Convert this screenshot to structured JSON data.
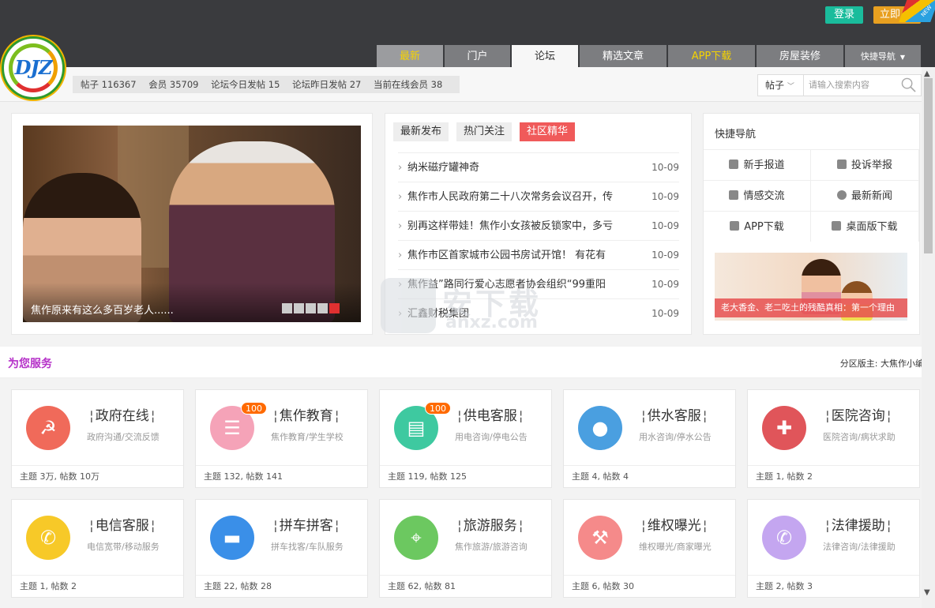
{
  "header": {
    "logo_text": "DJZ",
    "login_label": "登录",
    "register_label": "立即",
    "new_badge": "NEW",
    "tabs": [
      {
        "label": "最新"
      },
      {
        "label": "门户"
      },
      {
        "label": "论坛"
      },
      {
        "label": "精选文章"
      },
      {
        "label": "APP下载"
      },
      {
        "label": "房屋装修"
      },
      {
        "label": "快捷导航"
      }
    ]
  },
  "stats": {
    "posts": "帖子 116367",
    "members": "会员 35709",
    "today": "论坛今日发帖 15",
    "yesterday": "论坛昨日发帖 27",
    "online": "当前在线会员 38"
  },
  "search": {
    "type": "帖子",
    "placeholder": "请输入搜索内容"
  },
  "slider": {
    "caption": "焦作原来有这么多百岁老人......",
    "active_dot": 5,
    "dot_count": 5
  },
  "news": {
    "tabs": [
      "最新发布",
      "热门关注",
      "社区精华"
    ],
    "active_tab": 2,
    "items": [
      {
        "title": "纳米磁疗罐神奇",
        "date": "10-09"
      },
      {
        "title": "焦作市人民政府第二十八次常务会议召开，传",
        "date": "10-09"
      },
      {
        "title": "别再这样带娃！焦作小女孩被反锁家中，多亏",
        "date": "10-09"
      },
      {
        "title": "焦作市区首家城市公园书房试开馆！ 有花有",
        "date": "10-09"
      },
      {
        "title": "焦作益”路同行爱心志愿者协会组织“99重阳",
        "date": "10-09"
      },
      {
        "title": "汇鑫财税集团",
        "date": "10-09"
      }
    ]
  },
  "quick_nav": {
    "title": "快捷导航",
    "items": [
      {
        "label": "新手报道",
        "icon": "person-icon"
      },
      {
        "label": "投诉举报",
        "icon": "flag-icon"
      },
      {
        "label": "情感交流",
        "icon": "chat-icon"
      },
      {
        "label": "最新新闻",
        "icon": "info-icon"
      },
      {
        "label": "APP下载",
        "icon": "download-icon"
      },
      {
        "label": "桌面版下载",
        "icon": "download-icon"
      }
    ],
    "banner_caption": "老大香金、老二吃土的残酷真相：第一个理由"
  },
  "services_section": {
    "title": "为您服务",
    "moderator": "分区版主: 大焦作小编"
  },
  "services": [
    {
      "name": "政府在线",
      "desc": "政府沟通/交流反馈",
      "stats": "主题 3万, 帖数 10万",
      "color": "#f06a5a",
      "icon": "party-emblem-icon",
      "glyph": "☭",
      "badge": ""
    },
    {
      "name": "焦作教育",
      "desc": "焦作教育/学生学校",
      "stats": "主题 132, 帖数 141",
      "color": "#f5a3b8",
      "icon": "clipboard-icon",
      "glyph": "☰",
      "badge": "100"
    },
    {
      "name": "供电客服",
      "desc": "用电咨询/停电公告",
      "stats": "主题 119, 帖数 125",
      "color": "#3ec9a0",
      "icon": "list-icon",
      "glyph": "▤",
      "badge": "100"
    },
    {
      "name": "供水客服",
      "desc": "用水咨询/停水公告",
      "stats": "主题 4, 帖数 4",
      "color": "#4a9fe0",
      "icon": "water-drop-icon",
      "glyph": "●",
      "badge": ""
    },
    {
      "name": "医院咨询",
      "desc": "医院咨询/病状求助",
      "stats": "主题 1, 帖数 2",
      "color": "#e0555a",
      "icon": "medical-cross-icon",
      "glyph": "✚",
      "badge": ""
    },
    {
      "name": "电信客服",
      "desc": "电信宽带/移动服务",
      "stats": "主题 1, 帖数 2",
      "color": "#f7c928",
      "icon": "phone-icon",
      "glyph": "✆",
      "badge": ""
    },
    {
      "name": "拼车拼客",
      "desc": "拼车找客/车队服务",
      "stats": "主题 22, 帖数 28",
      "color": "#3a8fe8",
      "icon": "car-icon",
      "glyph": "▬",
      "badge": ""
    },
    {
      "name": "旅游服务",
      "desc": "焦作旅游/旅游咨询",
      "stats": "主题 62, 帖数 81",
      "color": "#6cc860",
      "icon": "map-pin-icon",
      "glyph": "⌖",
      "badge": ""
    },
    {
      "name": "维权曝光",
      "desc": "维权曝光/商家曝光",
      "stats": "主题 6, 帖数 30",
      "color": "#f58a8a",
      "icon": "gavel-icon",
      "glyph": "⚒",
      "badge": ""
    },
    {
      "name": "法律援助",
      "desc": "法律咨询/法律援助",
      "stats": "主题 2, 帖数 3",
      "color": "#c4a6f0",
      "icon": "phone-icon",
      "glyph": "✆",
      "badge": ""
    }
  ],
  "watermark": {
    "big": "安下载",
    "small": "anxz.com"
  }
}
